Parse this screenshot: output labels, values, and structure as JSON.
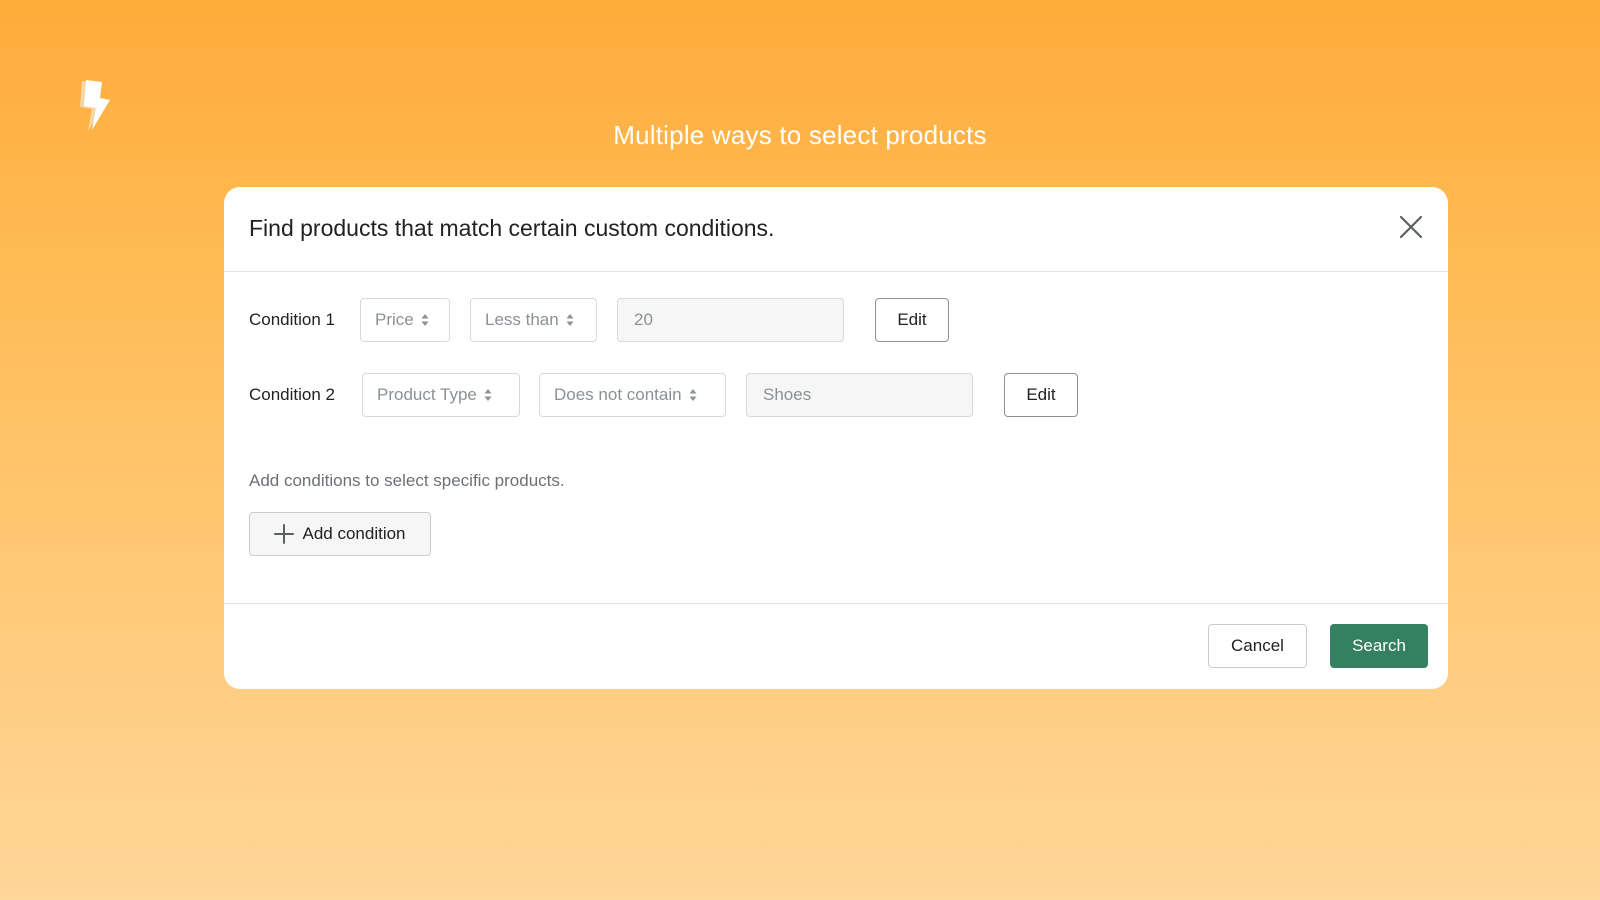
{
  "page": {
    "headline": "Multiple ways to select products",
    "logo_icon": "lightning-bolt-icon"
  },
  "modal": {
    "title": "Find products that match certain custom conditions.",
    "close_icon": "close-icon",
    "conditions": [
      {
        "label": "Condition 1",
        "field": "Price",
        "operator": "Less than",
        "value": "20",
        "edit_label": "Edit"
      },
      {
        "label": "Condition 2",
        "field": "Product Type",
        "operator": "Does not contain",
        "value": "Shoes",
        "edit_label": "Edit"
      }
    ],
    "helper_text": "Add conditions to select specific products.",
    "add_condition_label": "Add condition",
    "cancel_label": "Cancel",
    "search_label": "Search"
  },
  "colors": {
    "primary": "#348060",
    "background_top": "#ffab3a",
    "background_bottom": "#ffd699"
  }
}
